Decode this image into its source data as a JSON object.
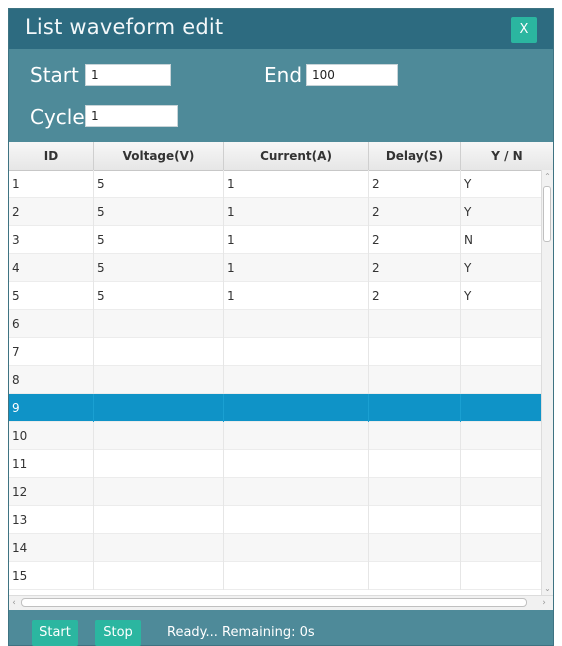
{
  "window": {
    "title": "List waveform edit",
    "close_label": "X"
  },
  "params": {
    "start_label": "Start",
    "start_value": "1",
    "end_label": "End",
    "end_value": "100",
    "cycle_label": "Cycle",
    "cycle_value": "1"
  },
  "table": {
    "columns": [
      "ID",
      "Voltage(V)",
      "Current(A)",
      "Delay(S)",
      "Y / N"
    ],
    "rows": [
      [
        "1",
        "5",
        "1",
        "2",
        "Y"
      ],
      [
        "2",
        "5",
        "1",
        "2",
        "Y"
      ],
      [
        "3",
        "5",
        "1",
        "2",
        "N"
      ],
      [
        "4",
        "5",
        "1",
        "2",
        "Y"
      ],
      [
        "5",
        "5",
        "1",
        "2",
        "Y"
      ],
      [
        "6",
        "",
        "",
        "",
        ""
      ],
      [
        "7",
        "",
        "",
        "",
        ""
      ],
      [
        "8",
        "",
        "",
        "",
        ""
      ],
      [
        "9",
        "",
        "",
        "",
        ""
      ],
      [
        "10",
        "",
        "",
        "",
        ""
      ],
      [
        "11",
        "",
        "",
        "",
        ""
      ],
      [
        "12",
        "",
        "",
        "",
        ""
      ],
      [
        "13",
        "",
        "",
        "",
        ""
      ],
      [
        "14",
        "",
        "",
        "",
        ""
      ],
      [
        "15",
        "",
        "",
        "",
        ""
      ]
    ],
    "selected_row": "9"
  },
  "footer": {
    "start_label": "Start",
    "stop_label": "Stop",
    "status_text": "Ready... Remaining: 0s"
  },
  "colors": {
    "titlebar": "#2d6b80",
    "panel": "#4e8a99",
    "accent_button": "#2bb6a0",
    "selection": "#0f93c7"
  }
}
